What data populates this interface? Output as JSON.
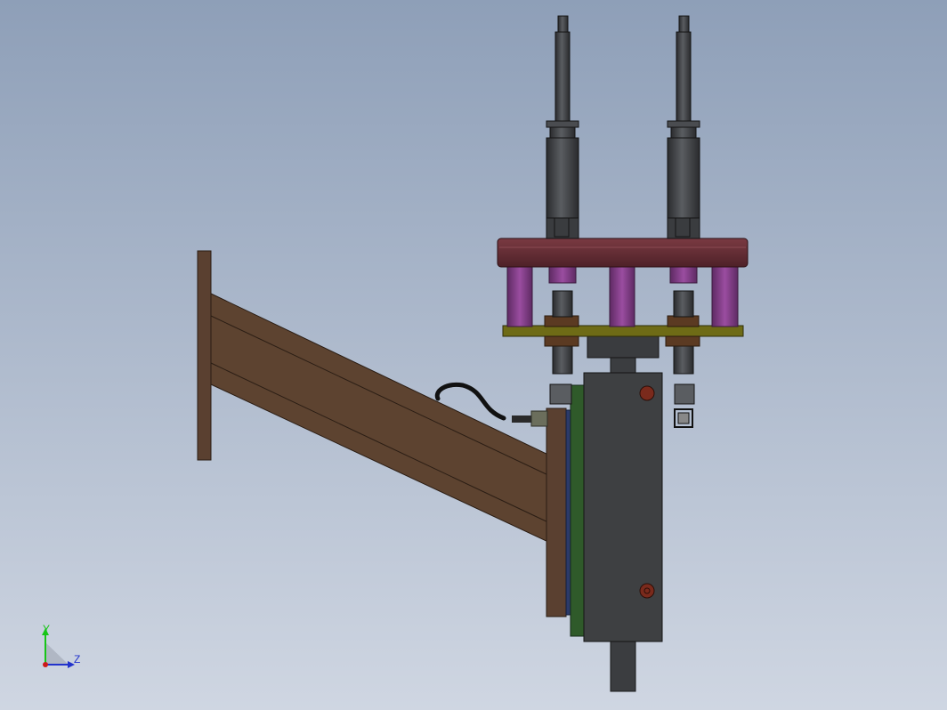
{
  "viewport": {
    "background_top": "#8e9fb8",
    "background_bottom": "#cfd6e2"
  },
  "triad": {
    "y_label": "Y",
    "z_label": "Z",
    "y_color": "#17c517",
    "z_color": "#2233cc",
    "origin_color": "#cc1a1a"
  },
  "colors": {
    "beam": "#5d4330",
    "beam_dark": "#3f2c1e",
    "cylinder": "#3b3d40",
    "cylinder_light": "#56595d",
    "top_plate": "#6b2f36",
    "posts": "#7a3a7e",
    "green_plate": "#6e6b16",
    "nut": "#5b3a22",
    "block": "#3e4042",
    "pin": "#7a2a1c",
    "back_green": "#2f4f2a",
    "cable": "#1a1a1a"
  }
}
